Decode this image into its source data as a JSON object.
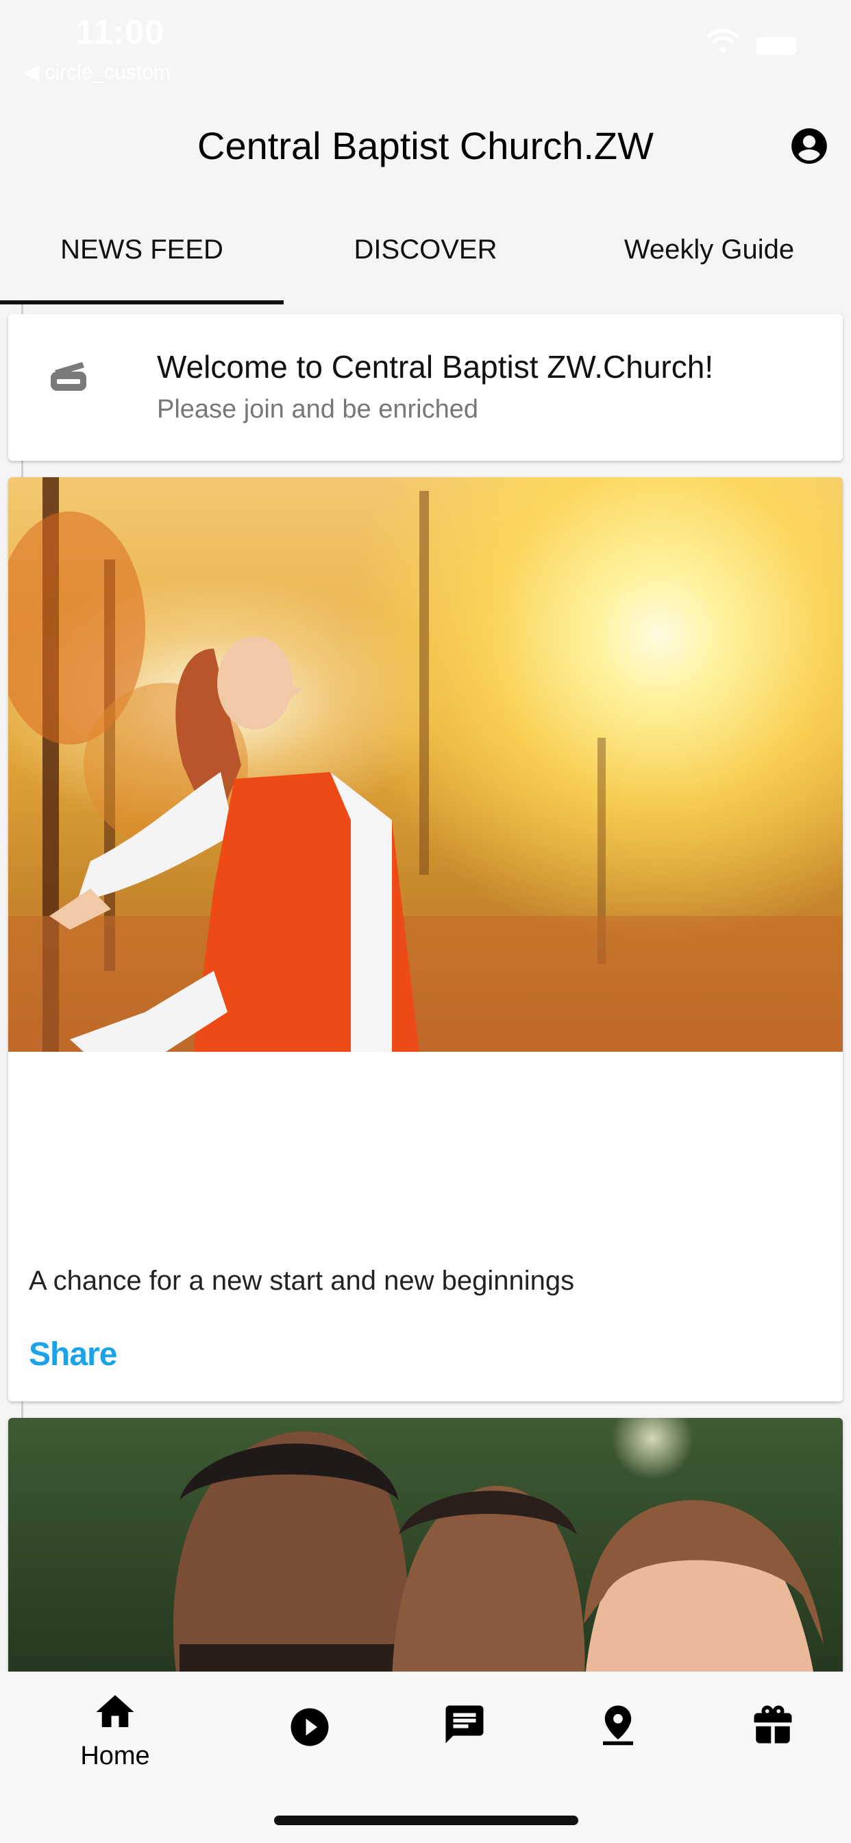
{
  "status_bar": {
    "time": "11:00",
    "back_label": "◀ circle_custom",
    "icons": [
      "wifi-icon",
      "battery-icon"
    ]
  },
  "header": {
    "title": "Central Baptist Church.ZW",
    "profile_icon": "account-circle-icon"
  },
  "tabs": [
    {
      "label": "NEWS FEED",
      "active": true
    },
    {
      "label": "DISCOVER",
      "active": false
    },
    {
      "label": "Weekly Guide",
      "active": false
    }
  ],
  "feed": {
    "welcome": {
      "icon": "printer-icon",
      "title": "Welcome to Central Baptist ZW.Church!",
      "subtitle": "Please join and be enriched"
    },
    "posts": [
      {
        "image": "woman in autumn park with arms outstretched",
        "caption": "A chance for a new start and new beginnings",
        "share_label": "Share"
      },
      {
        "image": "family smiling outdoors"
      }
    ]
  },
  "bottom_nav": [
    {
      "icon": "home-icon",
      "label": "Home",
      "active": true
    },
    {
      "icon": "play-circle-icon",
      "label": "",
      "active": false
    },
    {
      "icon": "message-icon",
      "label": "",
      "active": false
    },
    {
      "icon": "location-icon",
      "label": "",
      "active": false
    },
    {
      "icon": "gift-icon",
      "label": "",
      "active": false
    }
  ],
  "colors": {
    "accent": "#1aa3ea",
    "background": "#f5f5f5",
    "card": "#ffffff",
    "text": "#111111"
  }
}
